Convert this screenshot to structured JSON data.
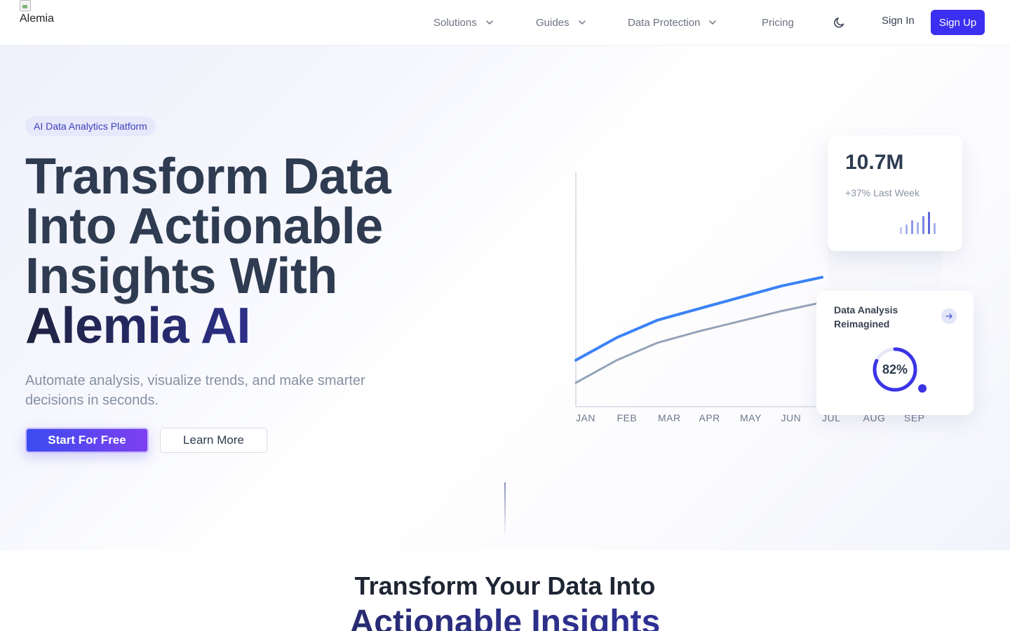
{
  "header": {
    "logo_alt": "Alemia",
    "nav": [
      {
        "label": "Solutions",
        "has_dropdown": true
      },
      {
        "label": "Guides",
        "has_dropdown": true
      },
      {
        "label": "Data Protection",
        "has_dropdown": true
      },
      {
        "label": "Pricing",
        "has_dropdown": false
      }
    ],
    "theme_toggle_icon": "moon-icon",
    "sign_in": "Sign In",
    "sign_up": "Sign Up",
    "accent": "#3b2ff0"
  },
  "hero": {
    "badge": "AI Data Analytics Platform",
    "title_lines": [
      "Transform Data",
      "Into Actionable",
      "Insights With"
    ],
    "title_brand": "Alemia AI",
    "subtitle": "Automate analysis, visualize trends, and make smarter decisions in seconds.",
    "cta_primary": "Start For Free",
    "cta_secondary": "Learn More"
  },
  "stat_card": {
    "value": "10.7M",
    "change": "+37% Last Week",
    "icon": "bar-chart-icon"
  },
  "analysis_card": {
    "title": "Data Analysis Reimagined",
    "percent_label": "82%",
    "percent": 82,
    "arrow_icon": "arrow-right-icon"
  },
  "section": {
    "title_line1": "Transform Your Data Into",
    "title_line2": "Actionable Insights"
  },
  "chart_data": {
    "type": "line",
    "categories": [
      "JAN",
      "FEB",
      "MAR",
      "APR",
      "MAY",
      "JUN",
      "JUL",
      "AUG",
      "SEP"
    ],
    "series": [
      {
        "values": [
          2,
          3.8,
          5.2,
          6.1,
          7,
          7.9,
          8.6,
          null,
          null
        ],
        "color": "#3b82f6"
      },
      {
        "values": [
          0.2,
          2,
          3.4,
          4.3,
          5.1,
          5.9,
          6.6,
          null,
          null
        ],
        "color": "#94a3b8"
      }
    ],
    "ylim": [
      -1.7,
      17
    ],
    "grid": false,
    "title": "",
    "xlabel": "",
    "ylabel": ""
  }
}
